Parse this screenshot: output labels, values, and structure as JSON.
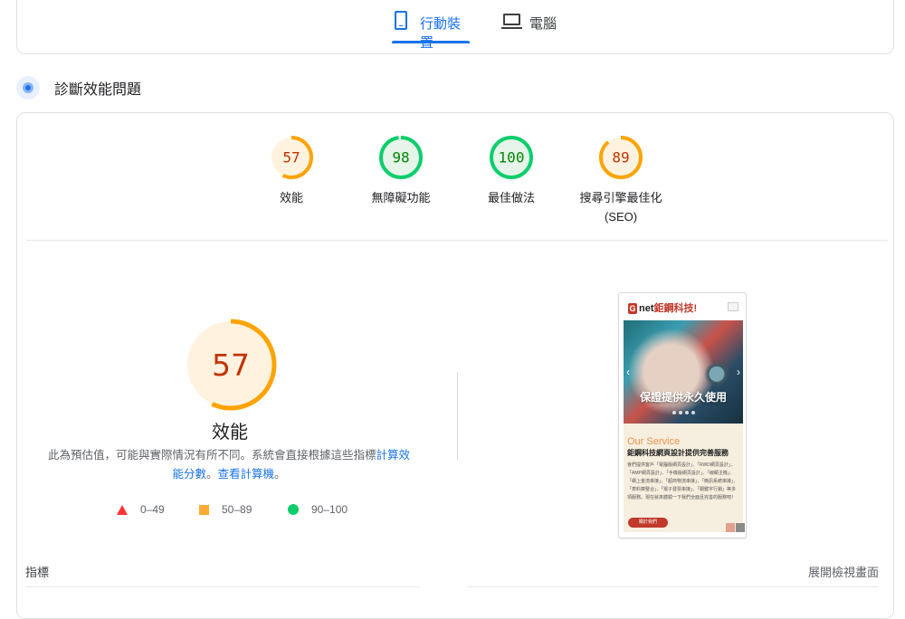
{
  "tabs": [
    {
      "label": "行動裝置",
      "icon": "phone-icon",
      "active": true
    },
    {
      "label": "電腦",
      "icon": "laptop-icon",
      "active": false
    }
  ],
  "diagnose": {
    "title": "診斷效能問題",
    "icon": "lighthouse-icon"
  },
  "scores": [
    {
      "value": "57",
      "score": 57,
      "label": "效能",
      "sublabel": "",
      "color": "#ffa400",
      "textColor": "#c33300",
      "bg": "#fff3e0"
    },
    {
      "value": "98",
      "score": 98,
      "label": "無障礙功能",
      "sublabel": "",
      "color": "#0cce6b",
      "textColor": "#008800",
      "bg": "#e6f4ea"
    },
    {
      "value": "100",
      "score": 100,
      "label": "最佳做法",
      "sublabel": "",
      "color": "#0cce6b",
      "textColor": "#008800",
      "bg": "#e6f4ea"
    },
    {
      "value": "89",
      "score": 89,
      "label": "搜尋引擎最佳化",
      "sublabel": "(SEO)",
      "color": "#ffa400",
      "textColor": "#c33300",
      "bg": "#fff3e0"
    }
  ],
  "performance": {
    "value": "57",
    "score": 57,
    "label": "效能",
    "note_text": "此為預估值，可能與實際情況有所不同。系統會直接根據這些指標",
    "note_link": "計算效能分數",
    "note_sep": "。",
    "calc_link": "查看計算機",
    "note_end": "。"
  },
  "legend": [
    {
      "range": "0–49",
      "shape": "triangle",
      "color": "#ff3333"
    },
    {
      "range": "50–89",
      "shape": "square",
      "color": "#ffaa33"
    },
    {
      "range": "90–100",
      "shape": "circle",
      "color": "#0cce6b"
    }
  ],
  "screenshot": {
    "logo_badge": "G",
    "logo_text": "net",
    "logo_brand": "鉅鋼科技!",
    "hero_text": "保證提供永久使用",
    "service_title": "Our Service",
    "service_subtitle": "鉅鋼科技網頁設計提供完善服務",
    "service_body": "會們提供客戶「電腦版網頁設計」、「RWD網頁設計」、「AMP網頁設計」、「手機版網頁設計」、「線顯主機」、「網上金流串接」、「超商物流串接」、「簡訊系統串接」、「表料庫整合」、「電子發票串接」、「關鍵字行銷」等多項服務。現在就來體驗一下我們全面且完善的服務吧！",
    "button_text": "關於我們"
  },
  "footer": {
    "metrics_label": "指標",
    "expand_label": "展開檢視畫面"
  }
}
